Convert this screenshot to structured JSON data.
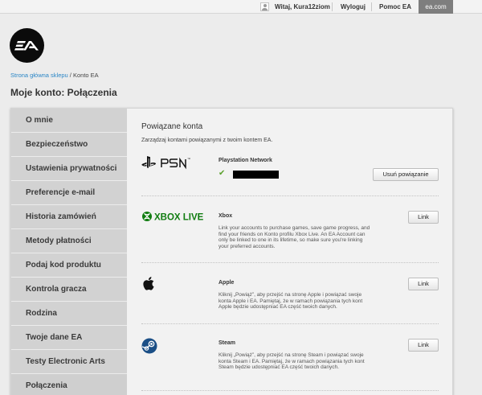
{
  "topbar": {
    "username": "Witaj, Kura12ziom",
    "logout": "Wyloguj",
    "help": "Pomoc EA",
    "site": "ea.com"
  },
  "breadcrumb": {
    "home": "Strona główna sklepu",
    "separator": " / ",
    "current": "Konto EA"
  },
  "page_title": "Moje konto: Połączenia",
  "sidebar": {
    "items": [
      {
        "label": "O mnie"
      },
      {
        "label": "Bezpieczeństwo"
      },
      {
        "label": "Ustawienia prywatności"
      },
      {
        "label": "Preferencje e-mail"
      },
      {
        "label": "Historia zamówień"
      },
      {
        "label": "Metody płatności"
      },
      {
        "label": "Podaj kod produktu"
      },
      {
        "label": "Kontrola gracza"
      },
      {
        "label": "Rodzina"
      },
      {
        "label": "Twoje dane EA"
      },
      {
        "label": "Testy Electronic Arts"
      },
      {
        "label": "Połączenia"
      }
    ],
    "active": "Połączenia"
  },
  "content": {
    "title": "Powiązane konta",
    "subtitle": "Zarządzaj kontami powiązanymi z twoim kontem EA.",
    "accounts": [
      {
        "logo_text": "PSN",
        "name": "Playstation Network",
        "button": "Usuń powiązanie",
        "linked": true
      },
      {
        "logo_text": "XBOX LIVE",
        "name": "Xbox",
        "description": "Link your accounts to purchase games, save game progress, and find your friends on Konto profilu Xbox Live. An EA Account can only be linked to one in its lifetime, so make sure you're linking your preferred accounts.",
        "button": "Link"
      },
      {
        "name": "Apple",
        "description": "Kliknij „Powiąż”, aby przejść na stronę Apple i powiązać swoje konta Apple i EA. Pamiętaj, że w ramach powiązania tych kont Apple będzie udostępniać EA część twoich danych.",
        "button": "Link"
      },
      {
        "name": "Steam",
        "description": "Kliknij „Powiąż”, aby przejść na stronę Steam i powiązać swoje konta Steam i EA. Pamiętaj, że w ramach powiązania tych kont Steam będzie udostępniać EA część twoich danych.",
        "button": "Link"
      }
    ]
  },
  "colors": {
    "link": "#2a86c6",
    "check": "#5aa02c",
    "xbox": "#107c10",
    "steam": "#1b2838",
    "ea_tab": "#7e7e7e"
  }
}
